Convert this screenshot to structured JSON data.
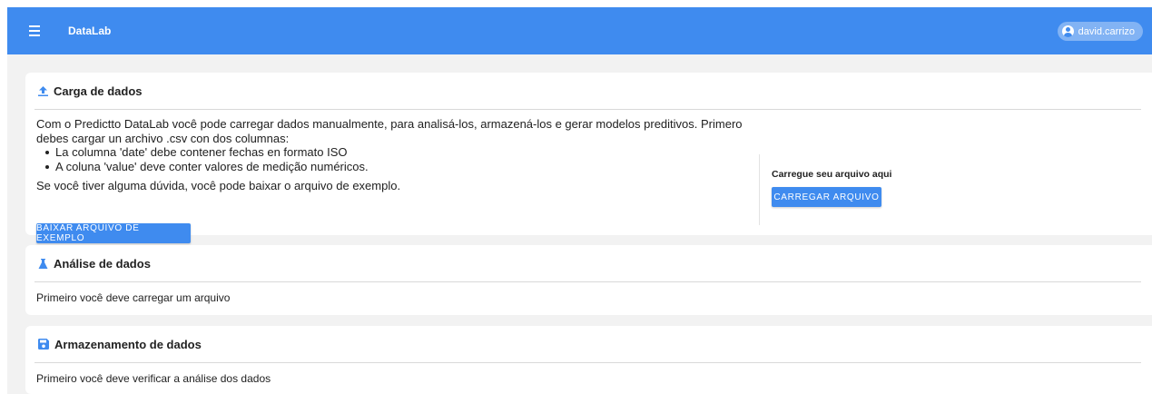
{
  "app": {
    "title": "DataLab",
    "user": "david.carrizo"
  },
  "colors": {
    "primary": "#3f8bef",
    "background": "#f2f2f2"
  },
  "upload": {
    "icon": "upload-icon",
    "title": "Carga de dados",
    "intro": "Com o Predictto DataLab você pode carregar dados manualmente, para analisá-los, armazená-los e gerar modelos preditivos. Primero debes cargar un archivo .csv con dos columnas:",
    "bullets": [
      "La columna 'date' debe contener fechas en formato ISO",
      "A coluna 'value' deve conter valores de medição numéricos."
    ],
    "help_text": "Se você tiver alguma dúvida, você pode baixar o arquivo de exemplo.",
    "download_button": "BAIXAR ARQUIVO DE EXEMPLO",
    "upload_label": "Carregue seu arquivo aqui",
    "upload_button": "CARREGAR ARQUIVO"
  },
  "analysis": {
    "icon": "flask-icon",
    "title": "Análise de dados",
    "message": "Primeiro você deve carregar um arquivo"
  },
  "storage": {
    "icon": "save-icon",
    "title": "Armazenamento de dados",
    "message": "Primeiro você deve verificar a análise dos dados"
  }
}
